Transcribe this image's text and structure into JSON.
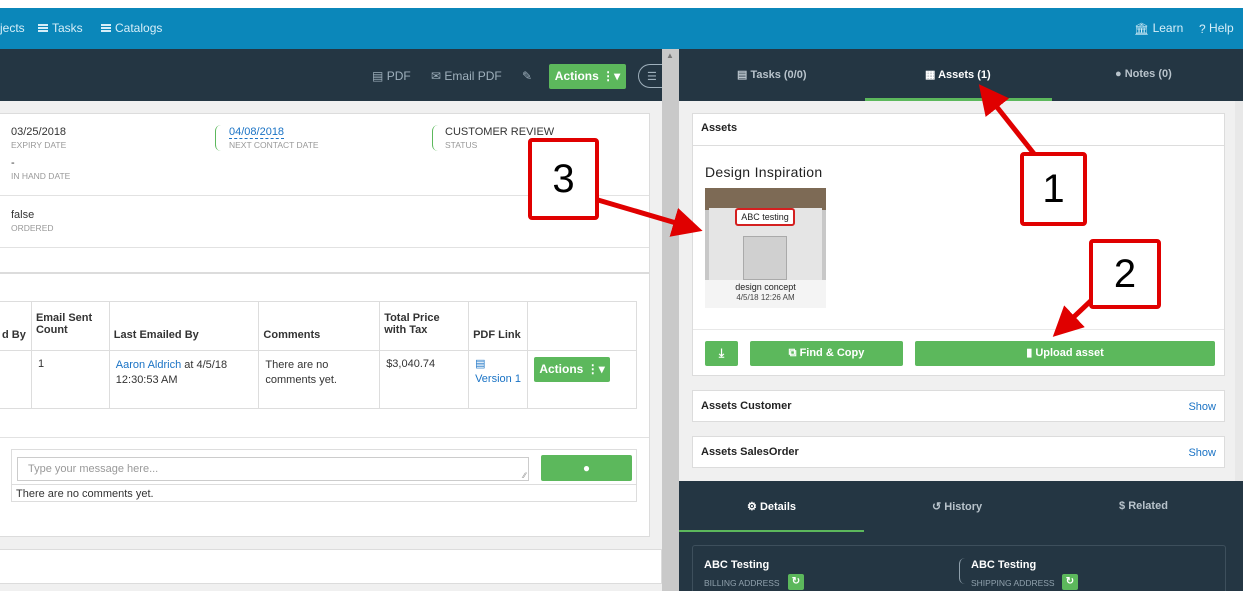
{
  "topnav": {
    "projects": "jects",
    "tasks": "Tasks",
    "catalogs": "Catalogs",
    "learn": "Learn",
    "help": "Help"
  },
  "toolbar": {
    "pdf": "PDF",
    "email_pdf": "Email PDF",
    "actions": "Actions"
  },
  "info": {
    "expiry_value": "03/25/2018",
    "expiry_label": "EXPIRY DATE",
    "next_contact_value": "04/08/2018",
    "next_contact_label": "NEXT CONTACT DATE",
    "status_value": "CUSTOMER REVIEW",
    "status_label": "STATUS",
    "in_hand_value": "-",
    "in_hand_label": "IN HAND DATE",
    "ordered_value": "false",
    "ordered_label": "ORDERED"
  },
  "table": {
    "headers": [
      "d By",
      "Email Sent Count",
      "Last Emailed By",
      "Comments",
      "Total Price with Tax",
      "PDF Link"
    ],
    "row": {
      "count": "1",
      "emailed_by_name": "Aaron Aldrich",
      "emailed_by_rest": " at 4/5/18 12:30:53 AM",
      "comments": "There are no comments yet.",
      "total": "$3,040.74",
      "pdf_link": "Version 1",
      "actions": "Actions"
    }
  },
  "comments": {
    "placeholder": "Type your message here...",
    "empty": "There are no comments yet."
  },
  "right_tabs": {
    "tasks": "Tasks (0/0)",
    "assets": "Assets (1)",
    "notes": "Notes (0)"
  },
  "assets": {
    "heading": "Assets",
    "group_title": "Design Inspiration",
    "thumb_sign": "ABC testing",
    "thumb_caption": "design concept",
    "thumb_date": "4/5/18 12:26 AM",
    "find_copy": "Find & Copy",
    "upload": "Upload asset",
    "customer_title": "Assets Customer",
    "salesorder_title": "Assets SalesOrder",
    "show": "Show"
  },
  "detail_tabs": {
    "details": "Details",
    "history": "History",
    "related": "Related"
  },
  "addresses": {
    "billing_name": "ABC Testing",
    "billing_label": "BILLING ADDRESS",
    "shipping_name": "ABC Testing",
    "shipping_label": "SHIPPING ADDRESS"
  },
  "callouts": {
    "one": "1",
    "two": "2",
    "three": "3"
  },
  "colors": {
    "topbar": "#0b87ba",
    "dark": "#243643",
    "green": "#5cb85c",
    "link": "#1a73c5",
    "annotation": "#e00000"
  }
}
